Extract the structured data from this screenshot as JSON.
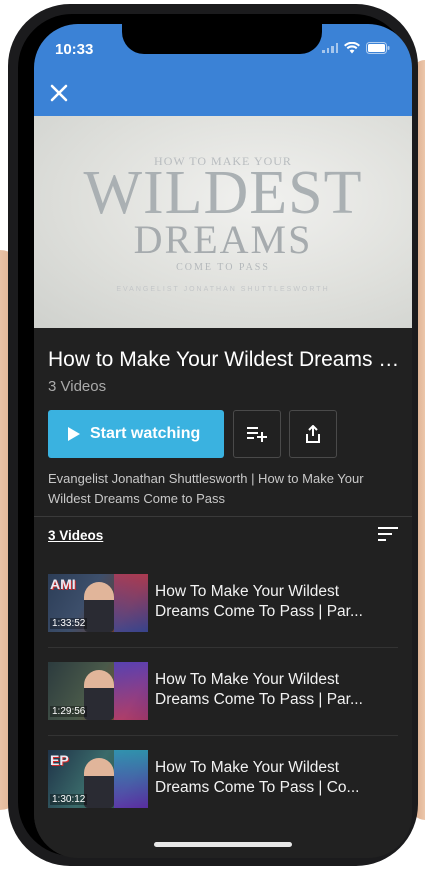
{
  "status_bar": {
    "time": "10:33"
  },
  "banner": {
    "top_line": "HOW TO MAKE YOUR",
    "headline_1": "WILDEST",
    "headline_2": "DREAMS",
    "sub_line": "COME TO PASS",
    "author_line": "EVANGELIST JONATHAN SHUTTLESWORTH"
  },
  "playlist": {
    "title": "How to Make Your Wildest Dreams Come to Pass",
    "count_label": "3 Videos",
    "start_label": "Start watching",
    "description": "Evangelist Jonathan Shuttlesworth | How to Make Your Wildest Dreams Come to Pass"
  },
  "videos_section": {
    "heading": "3 Videos"
  },
  "videos": [
    {
      "title": "How To Make Your Wildest Dreams Come To Pass | Par...",
      "duration": "1:33:52",
      "logo": "AMI"
    },
    {
      "title": "How To Make Your Wildest Dreams Come To Pass | Par...",
      "duration": "1:29:56",
      "logo": ""
    },
    {
      "title": "How To Make Your Wildest Dreams Come To Pass | Co...",
      "duration": "1:30:12",
      "logo": "EP"
    }
  ],
  "colors": {
    "app_bar": "#3b82d6",
    "primary_button": "#3ab2e0",
    "background": "#212121"
  },
  "icons": [
    "close-icon",
    "play-icon",
    "add-to-queue-icon",
    "share-icon",
    "sort-icon",
    "wifi-icon",
    "battery-icon",
    "location-arrow-icon"
  ]
}
